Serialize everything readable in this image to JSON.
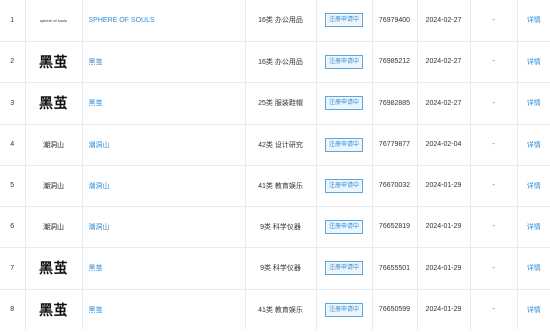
{
  "rows": [
    {
      "index": "1",
      "logo": "sphere of souls",
      "logo_style": "small",
      "name": "SPHERE OF SOULS",
      "category": "16类 办公用品",
      "status": "注册申请中",
      "reg_no": "76979400",
      "date": "2024-02-27",
      "extra": "-",
      "action": "详情"
    },
    {
      "index": "2",
      "logo": "黑茧",
      "logo_style": "big",
      "name": "黑茧",
      "category": "16类 办公用品",
      "status": "注册申请中",
      "reg_no": "76985212",
      "date": "2024-02-27",
      "extra": "-",
      "action": "详情"
    },
    {
      "index": "3",
      "logo": "黑茧",
      "logo_style": "big",
      "name": "黑茧",
      "category": "25类 服装鞋帽",
      "status": "注册申请中",
      "reg_no": "76982885",
      "date": "2024-02-27",
      "extra": "-",
      "action": "详情"
    },
    {
      "index": "4",
      "logo": "潮洞山",
      "logo_style": "mid",
      "name": "潮洞山",
      "category": "42类 设计研究",
      "status": "注册申请中",
      "reg_no": "76779877",
      "date": "2024-02-04",
      "extra": "-",
      "action": "详情"
    },
    {
      "index": "5",
      "logo": "潮洞山",
      "logo_style": "mid",
      "name": "潮洞山",
      "category": "41类 教育娱乐",
      "status": "注册申请中",
      "reg_no": "76670032",
      "date": "2024-01-29",
      "extra": "-",
      "action": "详情"
    },
    {
      "index": "6",
      "logo": "潮洞山",
      "logo_style": "mid",
      "name": "潮洞山",
      "category": "9类 科学仪器",
      "status": "注册申请中",
      "reg_no": "76652819",
      "date": "2024-01-29",
      "extra": "-",
      "action": "详情"
    },
    {
      "index": "7",
      "logo": "黑茧",
      "logo_style": "big",
      "name": "黑茧",
      "category": "9类 科学仪器",
      "status": "注册申请中",
      "reg_no": "76655501",
      "date": "2024-01-29",
      "extra": "-",
      "action": "详情"
    },
    {
      "index": "8",
      "logo": "黑茧",
      "logo_style": "big",
      "name": "黑茧",
      "category": "41类 教育娱乐",
      "status": "注册申请中",
      "reg_no": "76650599",
      "date": "2024-01-29",
      "extra": "-",
      "action": "详情"
    }
  ],
  "colors": {
    "link": "#2f8cd6",
    "border": "#e8ebf0",
    "badge_bg": "#eef6fd"
  }
}
